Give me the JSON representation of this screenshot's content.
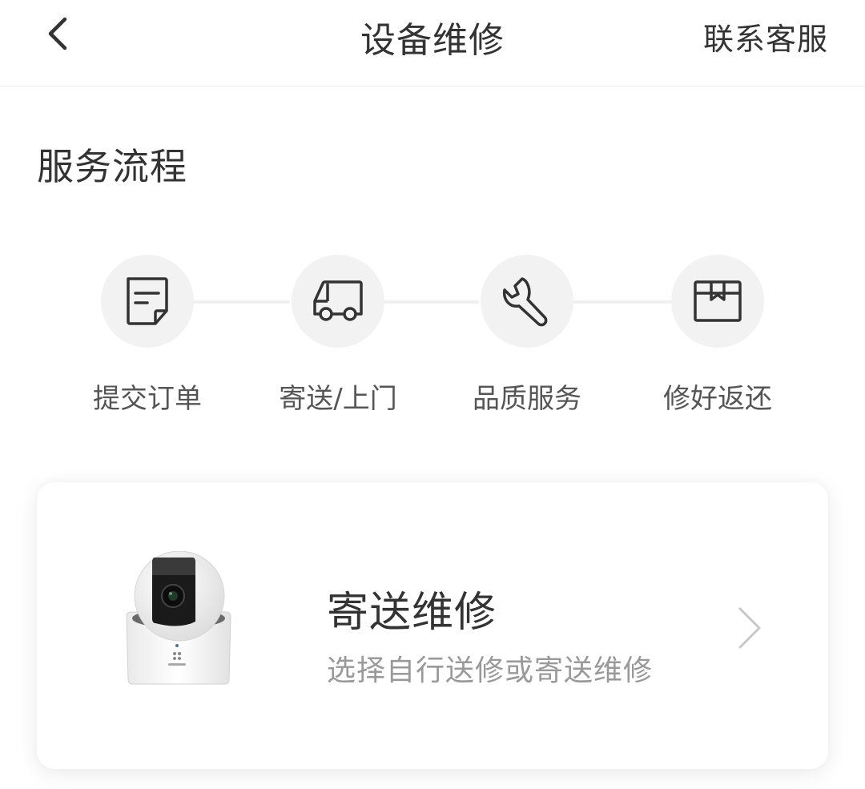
{
  "navbar": {
    "back_icon": "chevron-left-icon",
    "title": "设备维修",
    "service_link": "联系客服"
  },
  "section": {
    "title": "服务流程"
  },
  "steps": [
    {
      "label": "提交订单",
      "icon": "document-icon"
    },
    {
      "label": "寄送/上门",
      "icon": "truck-icon"
    },
    {
      "label": "品质服务",
      "icon": "wrench-icon"
    },
    {
      "label": "修好返还",
      "icon": "package-icon"
    }
  ],
  "card": {
    "title": "寄送维修",
    "subtitle": "选择自行送修或寄送维修",
    "image": "security-camera",
    "chevron_icon": "chevron-right-icon"
  },
  "colors": {
    "text_primary": "#333333",
    "text_secondary": "#999999",
    "step_circle": "#f2f2f2"
  }
}
